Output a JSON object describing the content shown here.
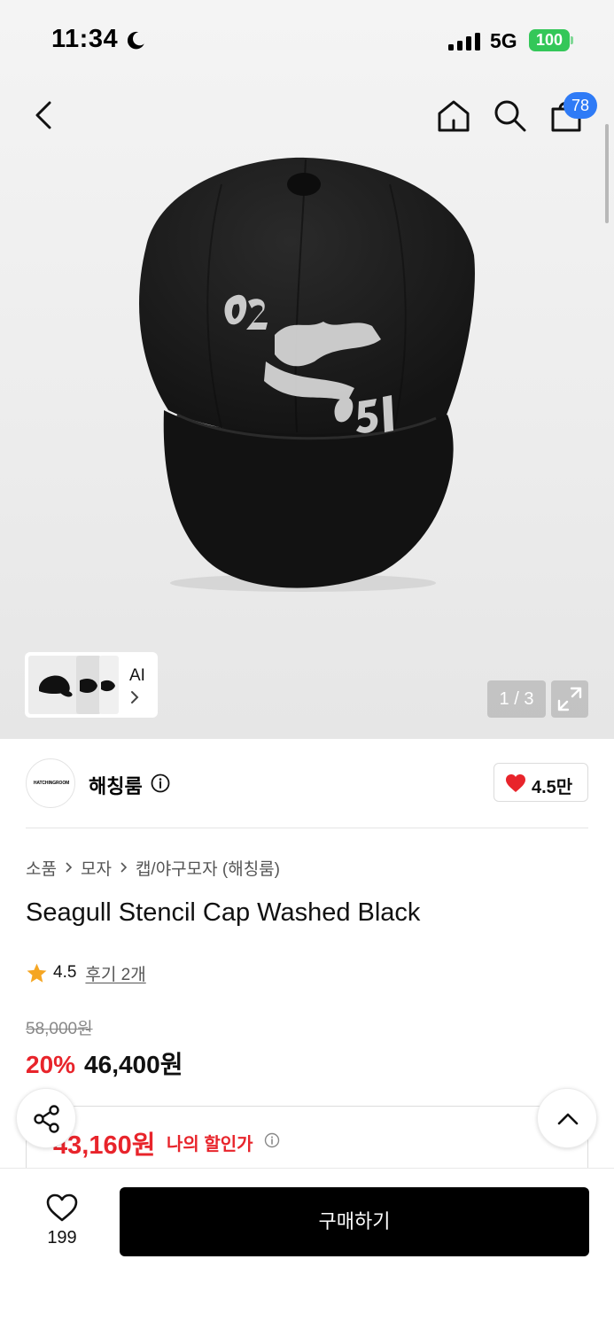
{
  "status_bar": {
    "time": "11:34",
    "network": "5G",
    "battery": "100",
    "moon_icon": "moon-icon",
    "signal_icon": "signal-bars-icon"
  },
  "header": {
    "icons": [
      "back-arrow-icon",
      "home-icon",
      "search-icon",
      "shopping-bag-icon"
    ],
    "cart_count": "78"
  },
  "gallery": {
    "ai_label": "AI",
    "page_indicator": "1 / 3",
    "current_page": 1,
    "total_pages": 3
  },
  "brand": {
    "name": "해칭룸",
    "logo_text": "HATCHINGROOM",
    "like_count": "4.5만"
  },
  "breadcrumb": [
    "소품",
    "모자",
    "캡/야구모자 (해칭룸)"
  ],
  "product": {
    "title": "Seagull Stencil Cap Washed Black",
    "rating": "4.5",
    "review_link": "후기 2개",
    "original_price": "58,000원",
    "discount_rate": "20%",
    "sale_price": "46,400원"
  },
  "coupon": {
    "price": "43,160원",
    "label": "나의 할인가"
  },
  "bottom_bar": {
    "wish_count": "199",
    "buy_label": "구매하기"
  },
  "colors": {
    "accent_red": "#e8242b",
    "badge_blue": "#2f7bf6",
    "battery_green": "#34c759",
    "buy_button": "#000000"
  }
}
